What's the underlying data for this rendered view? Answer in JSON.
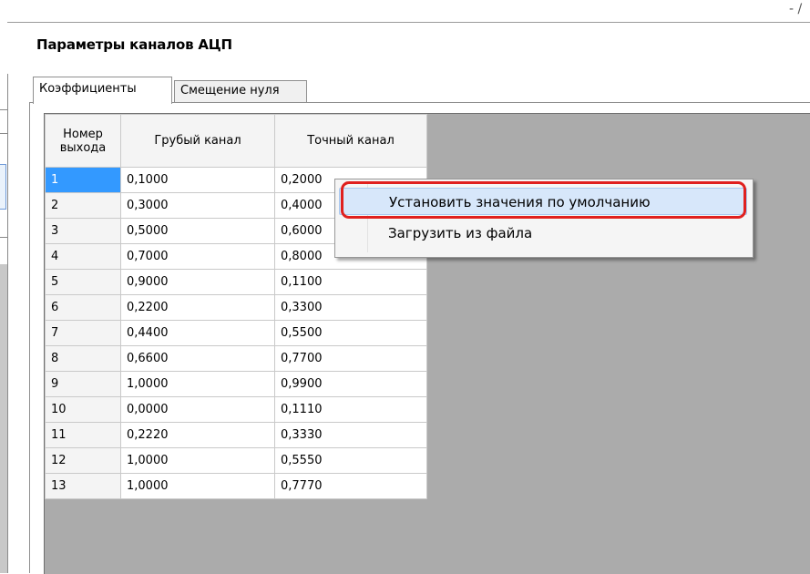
{
  "window": {
    "top_mark": "- /"
  },
  "group": {
    "title": "Параметры каналов АЦП"
  },
  "tabs": [
    {
      "label": "Коэффициенты",
      "active": true
    },
    {
      "label": "Смещение нуля",
      "active": false
    }
  ],
  "grid": {
    "headers": {
      "number": "Номер выхода",
      "coarse": "Грубый канал",
      "fine": "Точный канал"
    },
    "rows": [
      {
        "n": "1",
        "coarse": "0,1000",
        "fine": "0,2000"
      },
      {
        "n": "2",
        "coarse": "0,3000",
        "fine": "0,4000"
      },
      {
        "n": "3",
        "coarse": "0,5000",
        "fine": "0,6000"
      },
      {
        "n": "4",
        "coarse": "0,7000",
        "fine": "0,8000"
      },
      {
        "n": "5",
        "coarse": "0,9000",
        "fine": "0,1100"
      },
      {
        "n": "6",
        "coarse": "0,2200",
        "fine": "0,3300"
      },
      {
        "n": "7",
        "coarse": "0,4400",
        "fine": "0,5500"
      },
      {
        "n": "8",
        "coarse": "0,6600",
        "fine": "0,7700"
      },
      {
        "n": "9",
        "coarse": "1,0000",
        "fine": "0,9900"
      },
      {
        "n": "10",
        "coarse": "0,0000",
        "fine": "0,1110"
      },
      {
        "n": "11",
        "coarse": "0,2220",
        "fine": "0,3330"
      },
      {
        "n": "12",
        "coarse": "1,0000",
        "fine": "0,5550"
      },
      {
        "n": "13",
        "coarse": "1,0000",
        "fine": "0,7770"
      }
    ],
    "selected_row": 0
  },
  "context_menu": {
    "items": [
      {
        "label": "Установить значения по умолчанию",
        "highlighted": true
      },
      {
        "label": "Загрузить из файла",
        "highlighted": false
      }
    ]
  },
  "colors": {
    "selection": "#3399ff",
    "menu_hover": "#d7e7fa",
    "annotation_red": "#e0201e",
    "grid_background": "#ababab"
  }
}
